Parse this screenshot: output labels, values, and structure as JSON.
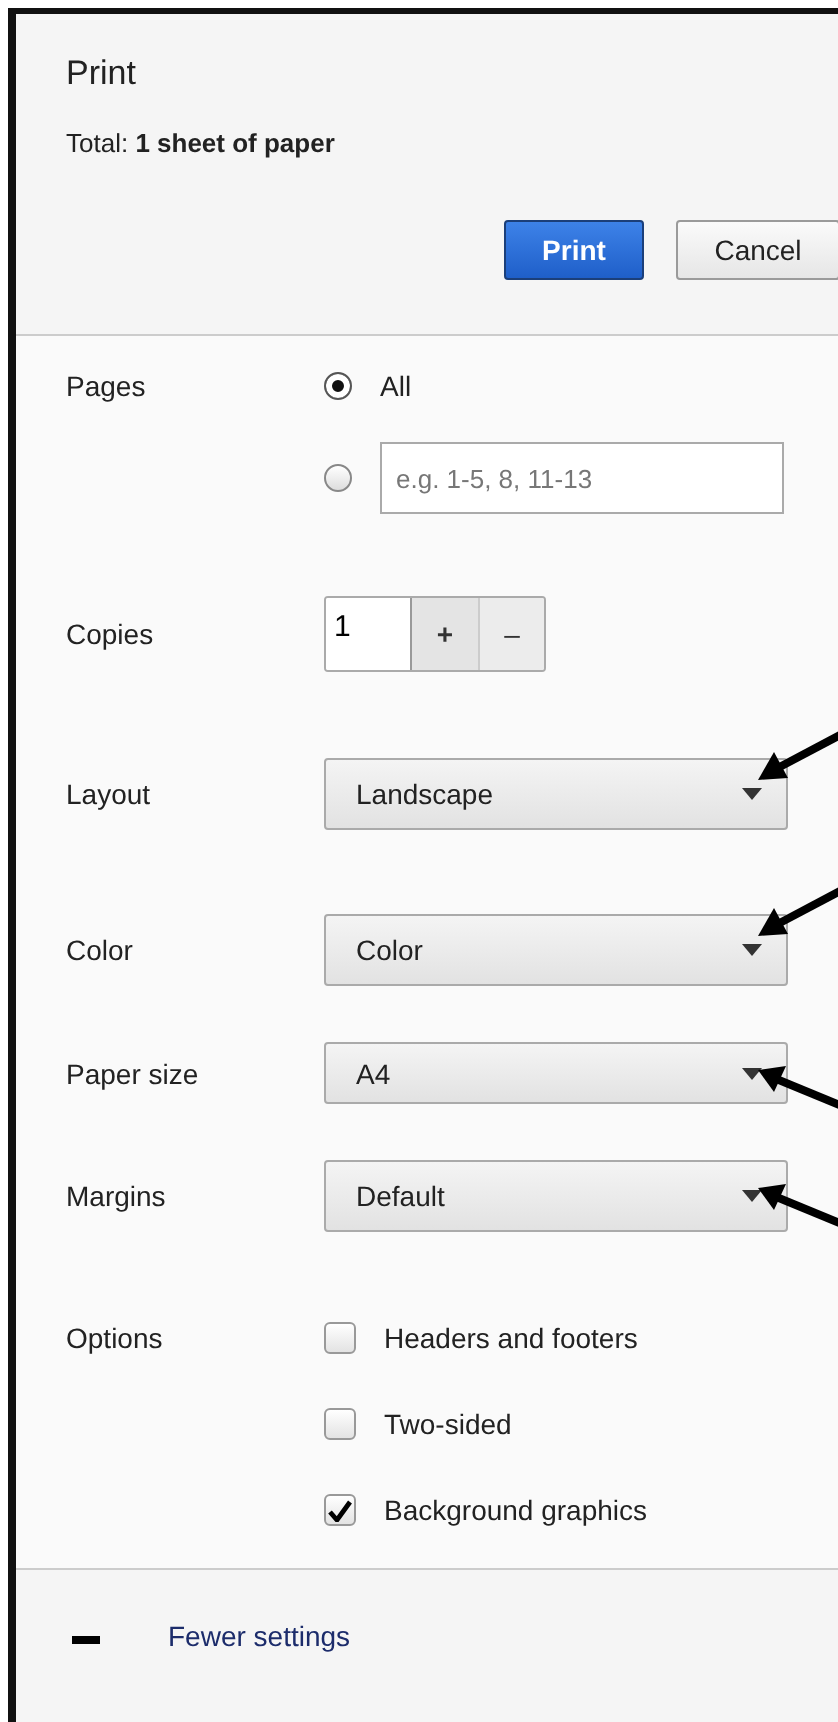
{
  "title": "Print",
  "total": "Total: **1 sheet of paper**",
  "buttons": [
    {
      "label": "Print",
      "kind": "primary"
    },
    {
      "label": "Cancel",
      "kind": "secondary"
    }
  ],
  "pages": {
    "label": "Pages",
    "options": [
      {
        "kind": "text",
        "label": "All",
        "selected": true
      },
      {
        "kind": "range",
        "placeholder": "e.g. 1-5, 8, 11-13",
        "selected": false
      }
    ]
  },
  "copies": {
    "label": "Copies",
    "value": "1",
    "steppers": [
      "+",
      "–"
    ]
  },
  "selects": [
    {
      "label": "Layout",
      "value": "Landscape",
      "kind": "arrowabove"
    },
    {
      "label": "Color",
      "value": "Color",
      "kind": "arrowabove"
    },
    {
      "label": "Paper size",
      "value": "A4",
      "kind": "arrowbelow"
    },
    {
      "label": "Margins",
      "value": "Default",
      "kind": "arrowbelow"
    }
  ],
  "options": {
    "label": "Options",
    "items": [
      {
        "label": "Headers and footers",
        "checked": false
      },
      {
        "label": "Two-sided",
        "checked": false
      },
      {
        "label": "Background graphics",
        "checked": true
      }
    ]
  },
  "footer": {
    "label": "Fewer settings"
  }
}
